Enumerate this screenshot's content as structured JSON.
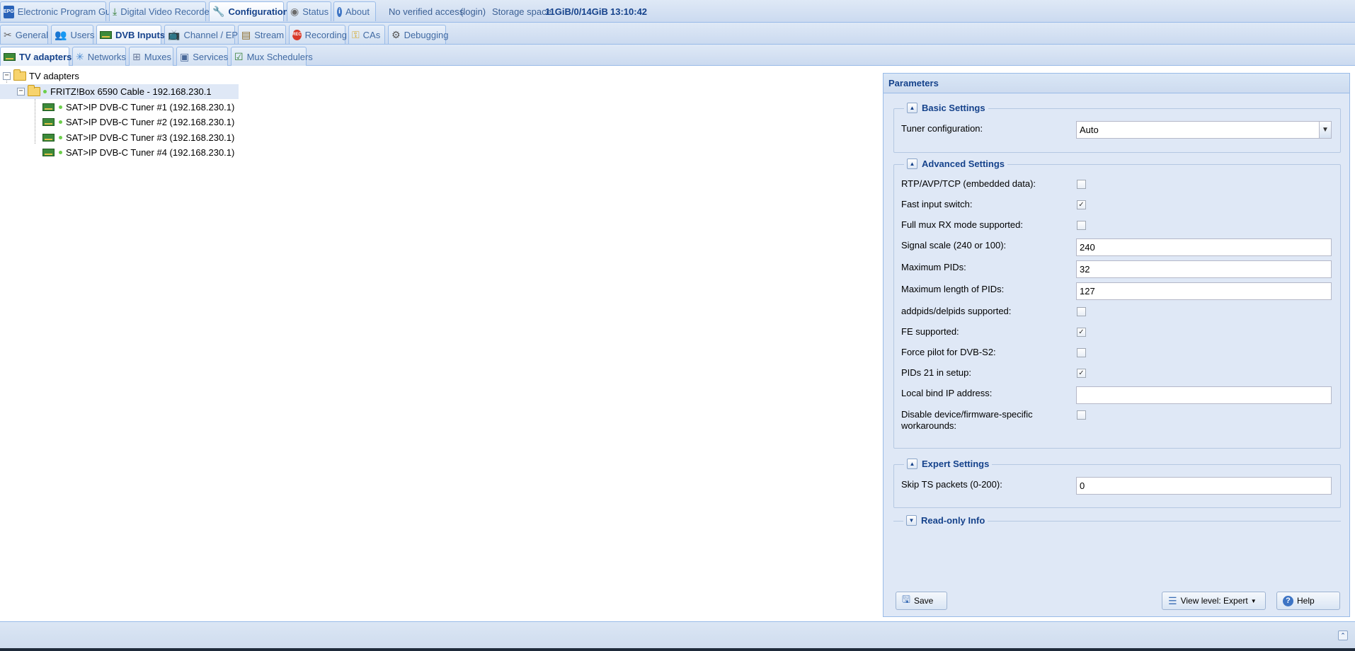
{
  "top_tabs": [
    {
      "label": "Electronic Program Guide",
      "icon": "epg-icon"
    },
    {
      "label": "Digital Video Recorder",
      "icon": "download-icon"
    },
    {
      "label": "Configuration",
      "icon": "wrench-icon",
      "active": true
    },
    {
      "label": "Status",
      "icon": "eye-icon"
    },
    {
      "label": "About",
      "icon": "info-icon"
    }
  ],
  "status": {
    "access": "No verified access",
    "login": "(login)",
    "storage_label": "Storage space:",
    "storage_value": "11GiB/0/14GiB",
    "time": "13:10:42"
  },
  "config_tabs": [
    {
      "label": "General",
      "icon": "tools-icon"
    },
    {
      "label": "Users",
      "icon": "users-icon"
    },
    {
      "label": "DVB Inputs",
      "icon": "tuner-card-icon",
      "active": true
    },
    {
      "label": "Channel / EPG",
      "icon": "tv-icon"
    },
    {
      "label": "Stream",
      "icon": "stream-icon"
    },
    {
      "label": "Recording",
      "icon": "rec-icon"
    },
    {
      "label": "CAs",
      "icon": "key-icon"
    },
    {
      "label": "Debugging",
      "icon": "bug-icon"
    }
  ],
  "dvb_tabs": [
    {
      "label": "TV adapters",
      "icon": "tuner-card-icon",
      "active": true
    },
    {
      "label": "Networks",
      "icon": "network-icon"
    },
    {
      "label": "Muxes",
      "icon": "mux-icon"
    },
    {
      "label": "Services",
      "icon": "services-icon"
    },
    {
      "label": "Mux Schedulers",
      "icon": "scheduler-icon"
    }
  ],
  "tree": {
    "root": "TV adapters",
    "device": "FRITZ!Box 6590 Cable - 192.168.230.1",
    "tuners": [
      "SAT>IP DVB-C Tuner #1 (192.168.230.1)",
      "SAT>IP DVB-C Tuner #2 (192.168.230.1)",
      "SAT>IP DVB-C Tuner #3 (192.168.230.1)",
      "SAT>IP DVB-C Tuner #4 (192.168.230.1)"
    ]
  },
  "params": {
    "title": "Parameters",
    "basic": {
      "title": "Basic Settings",
      "tuner_config_label": "Tuner configuration:",
      "tuner_config_value": "Auto"
    },
    "advanced": {
      "title": "Advanced Settings",
      "rtp_label": "RTP/AVP/TCP (embedded data):",
      "rtp_checked": false,
      "fast_switch_label": "Fast input switch:",
      "fast_switch_checked": true,
      "full_mux_label": "Full mux RX mode supported:",
      "full_mux_checked": false,
      "signal_scale_label": "Signal scale (240 or 100):",
      "signal_scale_value": "240",
      "max_pids_label": "Maximum PIDs:",
      "max_pids_value": "32",
      "max_pids_len_label": "Maximum length of PIDs:",
      "max_pids_len_value": "127",
      "addpids_label": "addpids/delpids supported:",
      "addpids_checked": false,
      "fe_label": "FE supported:",
      "fe_checked": true,
      "pilot_label": "Force pilot for DVB-S2:",
      "pilot_checked": false,
      "pids21_label": "PIDs 21 in setup:",
      "pids21_checked": true,
      "bind_ip_label": "Local bind IP address:",
      "bind_ip_value": "",
      "disable_wa_label_1": "Disable device/firmware-specific",
      "disable_wa_label_2": "workarounds:",
      "disable_wa_checked": false
    },
    "expert": {
      "title": "Expert Settings",
      "skip_ts_label": "Skip TS packets (0-200):",
      "skip_ts_value": "0"
    },
    "readonly": {
      "title": "Read-only Info"
    },
    "save_label": "Save",
    "view_level_label": "View level: Expert",
    "help_label": "Help"
  },
  "check_glyph": "✓"
}
